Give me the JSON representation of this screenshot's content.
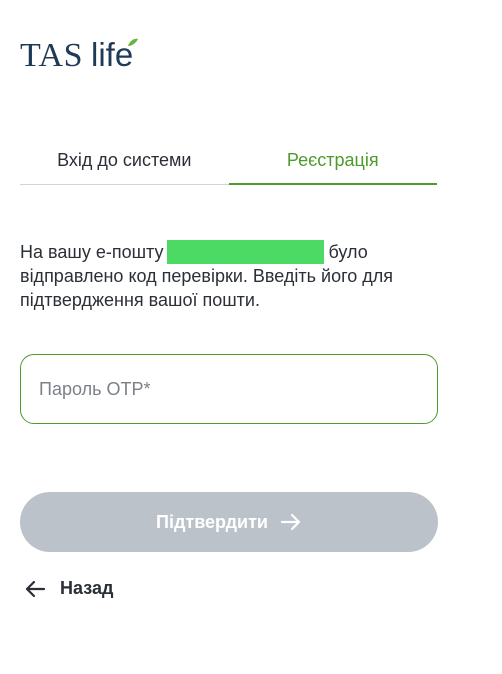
{
  "brand": {
    "logo_primary": "TAS",
    "logo_secondary": "life",
    "logo_color": "#1f3a57",
    "leaf_color": "#6bb33a"
  },
  "tabs": [
    {
      "label": "Вхід до системи",
      "active": false
    },
    {
      "label": "Реєстрація",
      "active": true
    }
  ],
  "message": {
    "before_email": "На вашу е-пошту",
    "after_email": "було відправлено код перевірки. Введіть його для підтвердження вашої пошти."
  },
  "otp": {
    "value": "",
    "placeholder": "Пароль OTP*"
  },
  "submit": {
    "label": "Підтвердити",
    "icon": "arrow-right-icon",
    "enabled": false
  },
  "back": {
    "label": "Назад",
    "icon": "arrow-left-icon"
  },
  "colors": {
    "accent": "#4e9a2b",
    "redaction": "#4cd964",
    "button_disabled": "#bcc2ca"
  }
}
